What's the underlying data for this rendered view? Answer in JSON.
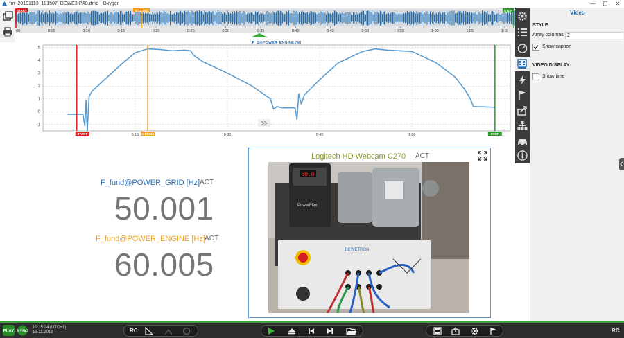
{
  "window": {
    "title": "*m_20191113_101507_DEWE3-PA8.dmd - Oxygen",
    "minimize": "—",
    "maximize": "☐",
    "close": "✕"
  },
  "overview": {
    "start_tag": "START",
    "stop_tag": "STOP",
    "cursor_tag": "0:17.042",
    "ticks": [
      "0:00",
      "0:05",
      "0:10",
      "0:15",
      "0:20",
      "0:25",
      "0:30",
      "0:35",
      "0:40",
      "0:45",
      "0:50",
      "0:55",
      "1:00",
      "1:05",
      "1:10"
    ],
    "colors": {
      "waveform": "#2e6ea8",
      "start": "#e02020",
      "stop": "#2a9a2a",
      "cursor": "#f0a020"
    }
  },
  "chart_data": {
    "type": "line",
    "title": "P_1@POWER_ENGINE [W]",
    "xlabel": "",
    "ylabel": "",
    "ylim": [
      -1.5,
      5.2
    ],
    "yticks": [
      "5",
      "4",
      "3",
      "2",
      "1",
      "0",
      "-1"
    ],
    "xticks": [
      "0:15",
      "0:30",
      "0:45",
      "1:00"
    ],
    "grid": true,
    "start_tag": "START",
    "stop_tag": "STOP",
    "cursor_tag": "0:17.042",
    "markers": {
      "start": 5.5,
      "cursor": 17.042,
      "stop": 73.5
    },
    "series": [
      {
        "color": "#4a90c8",
        "x": [
          4,
          6.5,
          6.8,
          7.0,
          7.2,
          7.5,
          8.0,
          10,
          13,
          15,
          17,
          19,
          21,
          23,
          24,
          24.5,
          26,
          30,
          34,
          37,
          37.5,
          38,
          39,
          41,
          41.3,
          41.6,
          42,
          42.5,
          45,
          48,
          52,
          54,
          56,
          58,
          60,
          64,
          67,
          68.5,
          69.5,
          70,
          73.5
        ],
        "y": [
          -0.2,
          -0.2,
          -1.1,
          0.9,
          -1.5,
          1.2,
          1.6,
          2.5,
          3.8,
          4.6,
          4.9,
          4.85,
          4.75,
          4.8,
          4.75,
          4.4,
          3.9,
          3.0,
          2.0,
          1.0,
          0.2,
          0.4,
          0.3,
          0.3,
          -0.6,
          1.4,
          0.6,
          1.3,
          2.5,
          3.8,
          4.7,
          4.9,
          4.8,
          4.75,
          4.7,
          3.8,
          2.7,
          1.8,
          1.0,
          0.4,
          0.35
        ]
      }
    ]
  },
  "displays": [
    {
      "label": "F_fund@POWER_GRID [Hz]",
      "act": "ACT",
      "value": "50.001",
      "color": "#2a6db0"
    },
    {
      "label": "F_fund@POWER_ENGINE [Hz]",
      "act": "ACT",
      "value": "60.005",
      "color": "#f0a020"
    }
  ],
  "video": {
    "caption": "Logitech HD Webcam C270 ",
    "act": "ACT",
    "frame_labels": {
      "drive_brand": "PowerFlex",
      "drive_display": "60.0",
      "panel_brand": "DEWETRON"
    }
  },
  "props": {
    "title": "Video",
    "style_header": "STYLE",
    "array_columns_label": "Array columns",
    "array_columns_value": "2",
    "show_caption_label": "Show caption",
    "show_caption_checked": true,
    "video_display_header": "VIDEO DISPLAY",
    "show_time_label": "Show time",
    "show_time_checked": false
  },
  "bottombar": {
    "play_label": "PLAY",
    "sync_label": "SYNC",
    "time": "10:15:24 (UTC+1)",
    "date": "13.11.2019",
    "rc_label": "RC",
    "right_rc_label": "RC"
  }
}
